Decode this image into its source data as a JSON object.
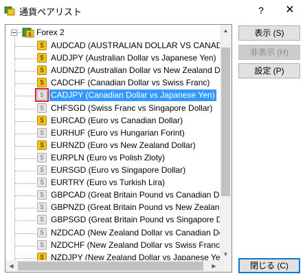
{
  "window": {
    "title": "通貨ペアリスト",
    "help": "?",
    "close": "✕"
  },
  "tree": {
    "root_label": "Forex 2",
    "items": [
      {
        "label": "AUDCAD  (AUSTRALIAN DOLLAR VS CANADIAN DOLLAR)",
        "active": true,
        "selected": false
      },
      {
        "label": "AUDJPY  (Australian Dollar vs Japanese Yen)",
        "active": true,
        "selected": false
      },
      {
        "label": "AUDNZD  (Australian Dollar vs New Zealand Dollar)",
        "active": true,
        "selected": false
      },
      {
        "label": "CADCHF  (Canadian Dollar vs Swiss Franc)",
        "active": true,
        "selected": false
      },
      {
        "label": "CADJPY  (Canadian Dollar vs Japanese Yen)",
        "active": false,
        "selected": true
      },
      {
        "label": "CHFSGD  (Swiss Franc vs Singapore Dollar)",
        "active": false,
        "selected": false
      },
      {
        "label": "EURCAD  (Euro vs Canadian Dollar)",
        "active": true,
        "selected": false
      },
      {
        "label": "EURHUF  (Euro vs Hungarian Forint)",
        "active": false,
        "selected": false
      },
      {
        "label": "EURNZD  (Euro vs New Zealand Dollar)",
        "active": true,
        "selected": false
      },
      {
        "label": "EURPLN  (Euro vs Polish Zloty)",
        "active": false,
        "selected": false
      },
      {
        "label": "EURSGD  (Euro vs Singapore Dollar)",
        "active": false,
        "selected": false
      },
      {
        "label": "EURTRY  (Euro vs Turkish Lira)",
        "active": false,
        "selected": false
      },
      {
        "label": "GBPCAD  (Great Britain Pound vs Canadian Dollar)",
        "active": false,
        "selected": false
      },
      {
        "label": "GBPNZD  (Great Britain Pound vs New Zealand Dollar)",
        "active": false,
        "selected": false
      },
      {
        "label": "GBPSGD  (Great Britain Pound vs Singapore Dollar)",
        "active": false,
        "selected": false
      },
      {
        "label": "NZDCAD  (New Zealand Dollar vs Canadian Dollar)",
        "active": false,
        "selected": false
      },
      {
        "label": "NZDCHF  (New Zealand Dollar vs Swiss Franc)",
        "active": false,
        "selected": false
      },
      {
        "label": "NZDJPY  (New Zealand Dollar vs Japanese Yen)",
        "active": true,
        "selected": false
      }
    ]
  },
  "buttons": {
    "show": "表示 (S)",
    "hide": "非表示 (H)",
    "settings": "設定 (P)",
    "close": "閉じる (C)"
  },
  "icons": {
    "app": "currency-pairs-icon",
    "root": "forex-folder-icon",
    "symbol_active": "dollar-coin-icon",
    "symbol_inactive": "dollar-coin-disabled-icon"
  },
  "colors": {
    "selection": "#3399ff",
    "coin_active": "#f3c41c",
    "coin_inactive": "#e8e8e8",
    "highlight_box": "#d0202a",
    "default_button_border": "#0078d7"
  }
}
